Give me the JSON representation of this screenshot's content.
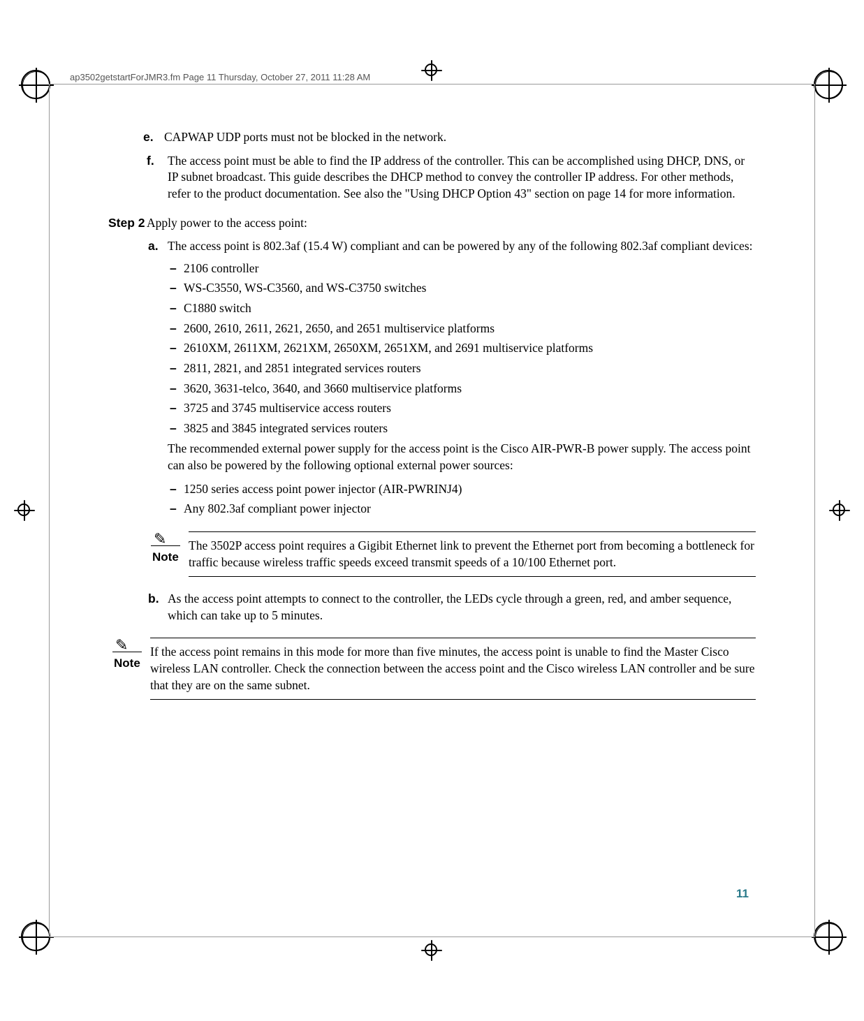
{
  "header": {
    "filename": "ap3502getstartForJMR3.fm  Page 11  Thursday, October 27, 2011  11:28 AM"
  },
  "items": {
    "e": {
      "marker": "e.",
      "text": "CAPWAP UDP ports must not be blocked in the network."
    },
    "f": {
      "marker": "f.",
      "text": "The access point must be able to find the IP address of the controller. This can be accomplished using DHCP, DNS, or IP subnet broadcast. This guide describes the DHCP method to convey the controller IP address. For other methods, refer to the product documentation. See also the \"Using DHCP Option 43\" section on page 14 for more information."
    }
  },
  "step2": {
    "label": "Step 2",
    "text": "Apply power to the access point:"
  },
  "sub_a": {
    "marker": "a.",
    "text": "The access point is 802.3af (15.4 W) compliant and can be powered by any of the following 802.3af compliant devices:"
  },
  "dashes1": [
    "2106 controller",
    "WS-C3550, WS-C3560, and WS-C3750 switches",
    "C1880 switch",
    "2600, 2610, 2611, 2621, 2650, and 2651 multiservice platforms",
    "2610XM, 2611XM, 2621XM, 2650XM, 2651XM, and 2691 multiservice platforms",
    "2811, 2821, and 2851 integrated services routers",
    "3620, 3631-telco, 3640, and 3660 multiservice platforms",
    "3725 and 3745 multiservice access routers",
    "3825 and 3845 integrated services routers"
  ],
  "para1": "The recommended external power supply for the access point is the Cisco AIR-PWR-B power supply. The access point can also be powered by the following optional external power sources:",
  "dashes2": [
    "1250 series access point power injector (AIR-PWRINJ4)",
    "Any 802.3af compliant power injector"
  ],
  "note1": {
    "label": "Note",
    "text": "The 3502P access point requires a Gigibit Ethernet link to prevent the Ethernet port from becoming a bottleneck for traffic because wireless traffic speeds exceed transmit speeds of a 10/100 Ethernet port."
  },
  "sub_b": {
    "marker": "b.",
    "text": "As the access point attempts to connect to the controller, the LEDs cycle through a green, red, and amber sequence, which can take up to 5 minutes."
  },
  "note2": {
    "label": "Note",
    "text": "If the access point remains in this mode for more than five minutes, the access point is unable to find the Master Cisco wireless LAN controller. Check the connection between the access point and the Cisco wireless LAN controller and be sure that they are on the same subnet."
  },
  "page_number": "11",
  "dash_char": "–"
}
